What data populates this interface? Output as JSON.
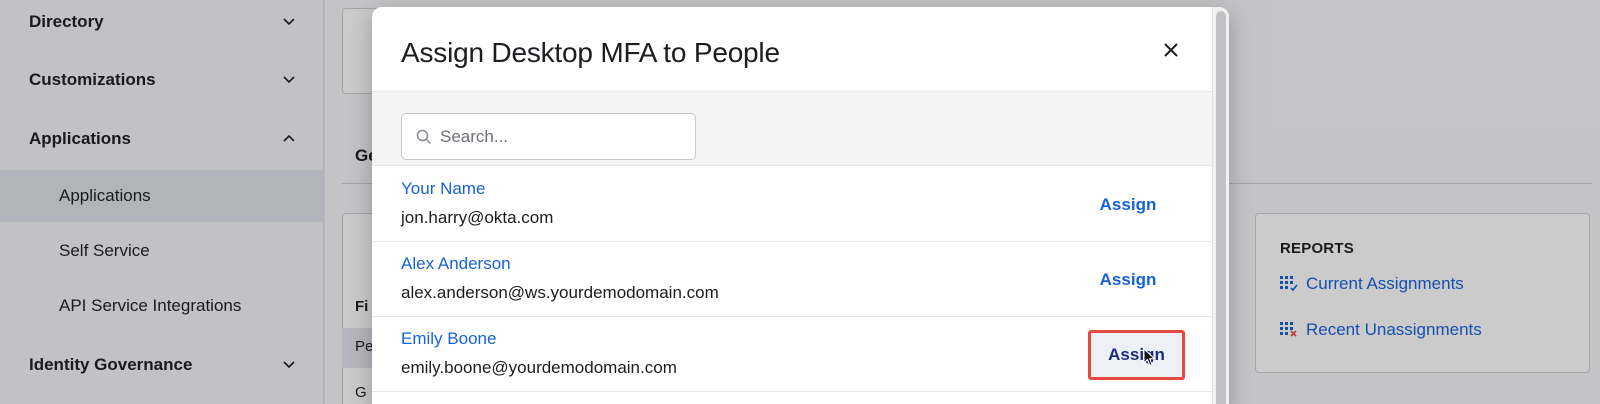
{
  "sidebar": {
    "sections": [
      {
        "label": "Directory",
        "expanded": false
      },
      {
        "label": "Customizations",
        "expanded": false
      },
      {
        "label": "Applications",
        "expanded": true
      },
      {
        "label": "Identity Governance",
        "expanded": false
      }
    ],
    "subitems": [
      {
        "label": "Applications",
        "active": true
      },
      {
        "label": "Self Service",
        "active": false
      },
      {
        "label": "API Service Integrations",
        "active": false
      }
    ]
  },
  "background": {
    "tab_stub": "Ge",
    "filter_stub": "Fi",
    "row1_stub": "Pe",
    "row2_stub": "G",
    "reports": {
      "title": "REPORTS",
      "links": [
        {
          "label": "Current Assignments",
          "icon": "grid-report-icon"
        },
        {
          "label": "Recent Unassignments",
          "icon": "grid-remove-report-icon"
        }
      ]
    }
  },
  "modal": {
    "title": "Assign Desktop MFA to People",
    "close_icon": "close-icon",
    "search": {
      "placeholder": "Search...",
      "value": ""
    },
    "people": [
      {
        "name": "Your Name",
        "email": "jon.harry@okta.com",
        "action": "Assign"
      },
      {
        "name": "Alex Anderson",
        "email": "alex.anderson@ws.yourdemodomain.com",
        "action": "Assign"
      },
      {
        "name": "Emily Boone",
        "email": "emily.boone@yourdemodomain.com",
        "action": "Assign"
      }
    ]
  },
  "colors": {
    "link_blue": "#1662dd",
    "highlight_red": "#e5493f",
    "remove_red": "#e5493f"
  }
}
